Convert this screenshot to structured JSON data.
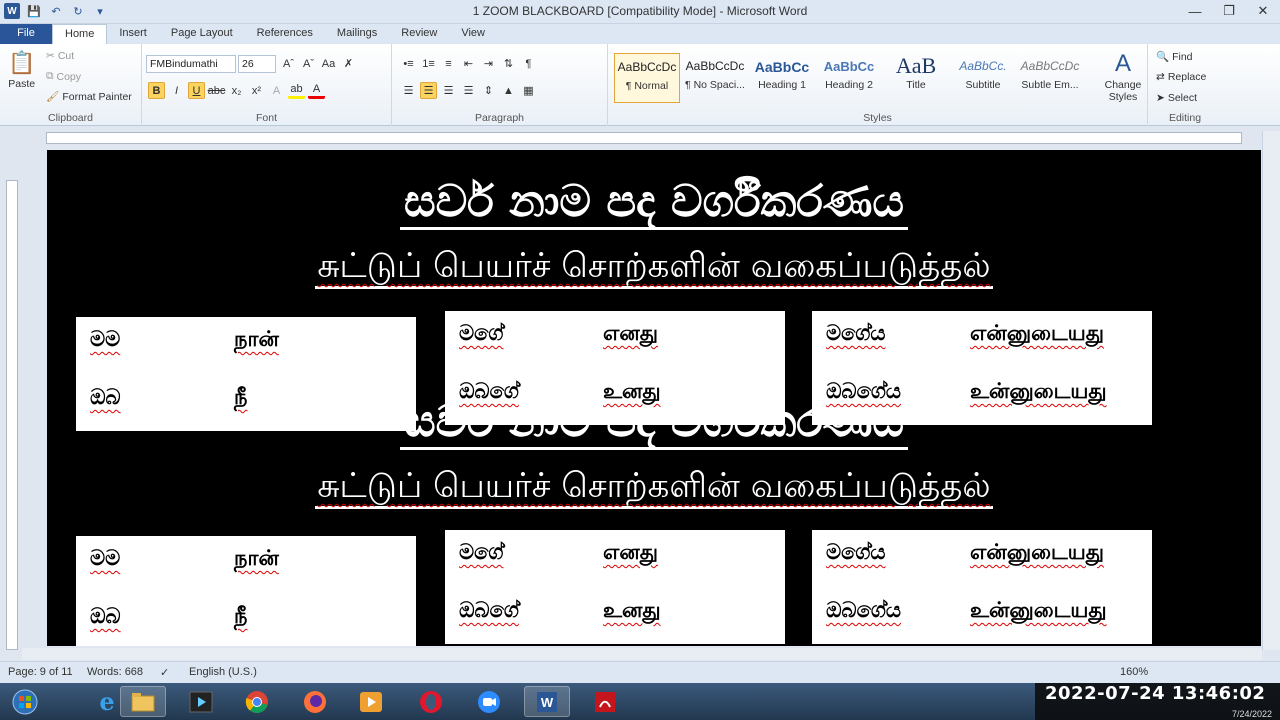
{
  "window": {
    "title": "1 ZOOM BLACKBOARD [Compatibility Mode]  -  Microsoft Word",
    "logo": "W"
  },
  "tabs": [
    "File",
    "Home",
    "Insert",
    "Page Layout",
    "References",
    "Mailings",
    "Review",
    "View"
  ],
  "ribbon": {
    "clipboard": {
      "label": "Clipboard",
      "paste": "Paste",
      "cut": "Cut",
      "copy": "Copy",
      "format_painter": "Format Painter"
    },
    "font": {
      "label": "Font",
      "font_name": "FMBindumathi",
      "font_size": "26"
    },
    "paragraph": {
      "label": "Paragraph"
    },
    "styles": {
      "label": "Styles",
      "items": [
        {
          "preview": "AaBbCcDc",
          "name": "¶ Normal"
        },
        {
          "preview": "AaBbCcDc",
          "name": "¶ No Spaci..."
        },
        {
          "preview": "AaBbCc",
          "name": "Heading 1"
        },
        {
          "preview": "AaBbCc",
          "name": "Heading 2"
        },
        {
          "preview": "AaB",
          "name": "Title"
        },
        {
          "preview": "AaBbCc.",
          "name": "Subtitle"
        },
        {
          "preview": "AaBbCcDc",
          "name": "Subtle Em..."
        }
      ],
      "change_styles": "Change Styles"
    },
    "editing": {
      "label": "Editing",
      "find": "Find",
      "replace": "Replace",
      "select": "Select"
    }
  },
  "document": {
    "sinhala_title": "සර්ව නාම පද වර්ගීකරණය",
    "tamil_title": "சுட்டுப் பெயர்ச் சொற்களின் வகைப்படுத்தல்",
    "boxes": [
      {
        "rows": [
          {
            "si": "මම",
            "ta": "நான்"
          },
          {
            "si": "ඔබ",
            "ta": "நீ"
          }
        ]
      },
      {
        "rows": [
          {
            "si": "මගේ",
            "ta": "எனது"
          },
          {
            "si": "ඔබගේ",
            "ta": "உனது"
          }
        ]
      },
      {
        "rows": [
          {
            "si": "මගේය",
            "ta": "என்னுடையது"
          },
          {
            "si": "ඔබගේය",
            "ta": "உன்னுடையது"
          }
        ]
      }
    ]
  },
  "status": {
    "page": "Page: 9 of 11",
    "words": "Words: 668",
    "language": "English (U.S.)",
    "zoom": "160%"
  },
  "clock": {
    "datetime": "2022-07-24  13:46:02",
    "date_small": "7/24/2022"
  }
}
